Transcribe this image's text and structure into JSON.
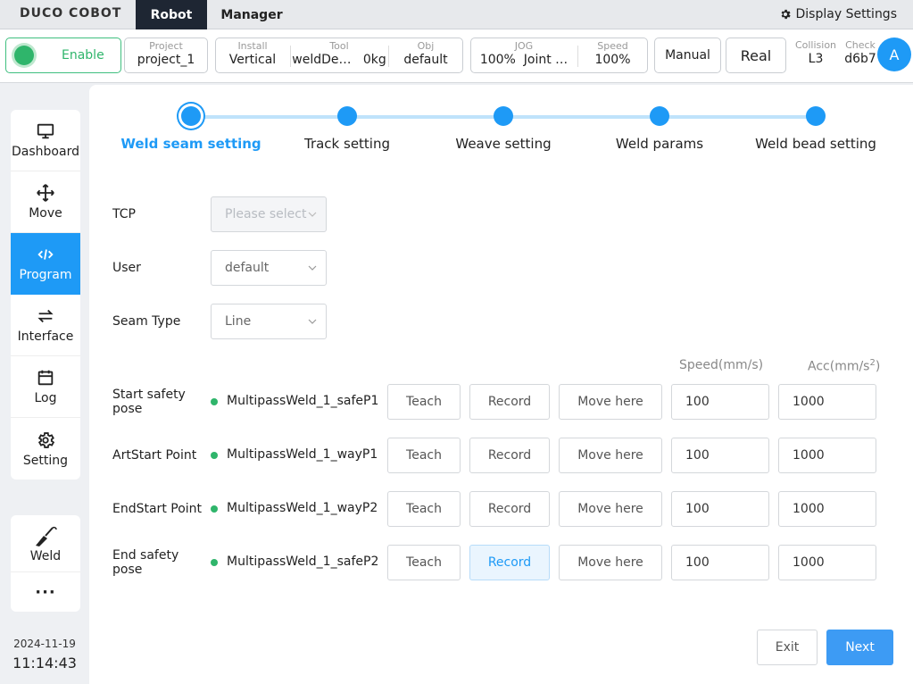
{
  "topbar": {
    "logo": "DUCO COBOT",
    "tabs": [
      "Robot",
      "Manager"
    ],
    "display_settings": "Display Settings"
  },
  "status": {
    "enable": "Enable",
    "project_title": "Project",
    "project_value": "project_1",
    "install_title": "Install",
    "install_value": "Vertical",
    "tool_title": "Tool",
    "tool_value": "weldDe…",
    "tool_weight": "0kg",
    "obj_title": "Obj",
    "obj_value": "default",
    "jog_title": "JOG",
    "jog_value": "100%",
    "jog_mode": "Joint …",
    "speed_title": "Speed",
    "speed_value": "100%",
    "manual": "Manual",
    "real": "Real",
    "collision_title": "Collision",
    "collision_value": "L3",
    "check_title": "Check",
    "check_value": "d6b7",
    "avatar": "A"
  },
  "nav": {
    "items": [
      {
        "label": "Dashboard",
        "icon": "monitor-icon"
      },
      {
        "label": "Move",
        "icon": "move-arrows-icon"
      },
      {
        "label": "Program",
        "icon": "code-icon",
        "active": true
      },
      {
        "label": "Interface",
        "icon": "swap-icon"
      },
      {
        "label": "Log",
        "icon": "calendar-icon"
      },
      {
        "label": "Setting",
        "icon": "gear-icon"
      }
    ],
    "weld": "Weld",
    "more": "···",
    "date": "2024-11-19",
    "time": "11:14:43"
  },
  "steps": {
    "labels": [
      "Weld seam setting",
      "Track setting",
      "Weave setting",
      "Weld params",
      "Weld bead setting"
    ],
    "current": 0
  },
  "form": {
    "tcp_label": "TCP",
    "tcp_placeholder": "Please select",
    "user_label": "User",
    "user_value": "default",
    "seam_label": "Seam Type",
    "seam_value": "Line"
  },
  "points": {
    "speed_header": "Speed(mm/s)",
    "acc_header": "Acc(mm/s",
    "acc_sup": "2",
    "acc_close": ")",
    "teach": "Teach",
    "record": "Record",
    "move_here": "Move here",
    "rows": [
      {
        "label": "Start safety pose",
        "name": "MultipassWeld_1_safeP1",
        "speed": "100",
        "acc": "1000"
      },
      {
        "label": "ArtStart Point",
        "name": "MultipassWeld_1_wayP1",
        "speed": "100",
        "acc": "1000"
      },
      {
        "label": "EndStart Point",
        "name": "MultipassWeld_1_wayP2",
        "speed": "100",
        "acc": "1000"
      },
      {
        "label": "End safety pose",
        "name": "MultipassWeld_1_safeP2",
        "speed": "100",
        "acc": "1000"
      }
    ]
  },
  "footer": {
    "exit": "Exit",
    "next": "Next"
  },
  "colors": {
    "accent": "#1e9af6",
    "enable_green": "#2fb56b",
    "nav_dark": "#1e2633"
  }
}
